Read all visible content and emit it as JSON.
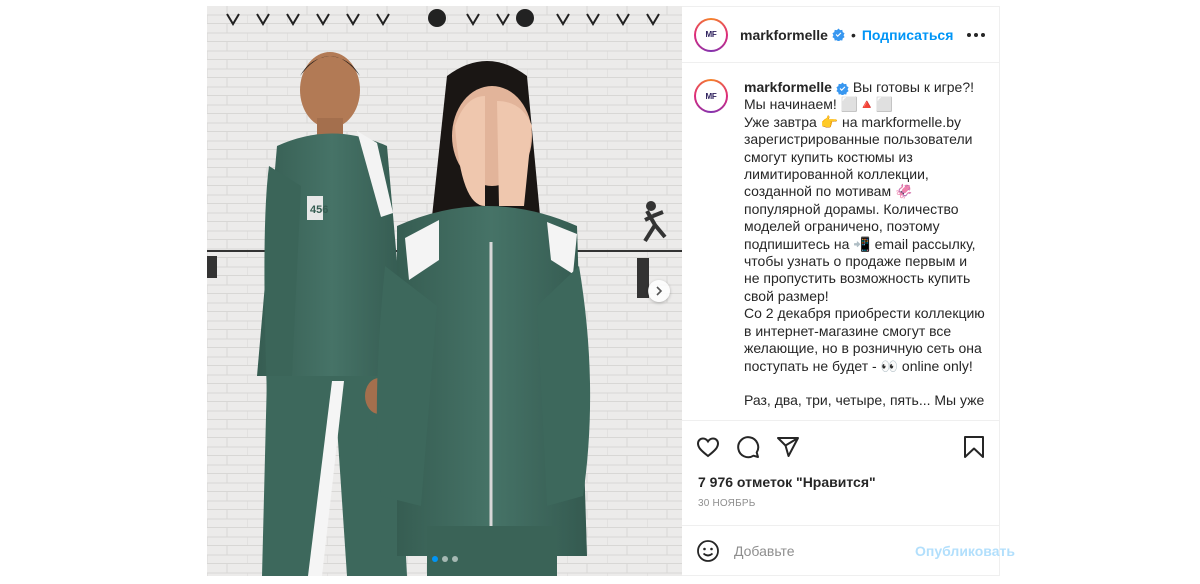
{
  "post": {
    "username": "markformelle",
    "bullet": "•",
    "follow_label": "Подписаться",
    "avatar_logo": "MF",
    "caption_text": " Вы готовы к игре?!\nМы начинаем! ⬜🔺⬜\nУже завтра 👉 на markformelle.by зарегистрированные пользователи смогут купить костюмы из лимитированной коллекции, созданной по мотивам 🦑 популярной дорамы. Количество моделей ограничено, поэтому подпишитесь на 📲 email рассылку, чтобы узнать о продаже первым и не пропустить возможность купить свой размер!\nСо 2 декабря приобрести коллекцию в интернет-магазине смогут все желающие, но в розничную сеть она поступать не будет - 👀 online only!\n\nРаз, два, три, четыре, пять... Мы уже",
    "likes": "7 976 отметок \"Нравится\"",
    "date": "30 НОЯБРЬ",
    "comment_placeholder": "Добавьте",
    "publish_label": "Опубликовать",
    "jersey_number": "456",
    "carousel": {
      "count": 3,
      "active": 0
    }
  },
  "icons": [
    "verified-icon",
    "more-icon",
    "heart-icon",
    "comment-icon",
    "share-icon",
    "bookmark-icon",
    "emoji-icon",
    "chevron-right-icon"
  ],
  "colors": {
    "accent": "#0095f6",
    "tracksuit": "#3f6b5e",
    "publish_disabled": "#b2dffc",
    "muted": "#8e8e8e"
  }
}
